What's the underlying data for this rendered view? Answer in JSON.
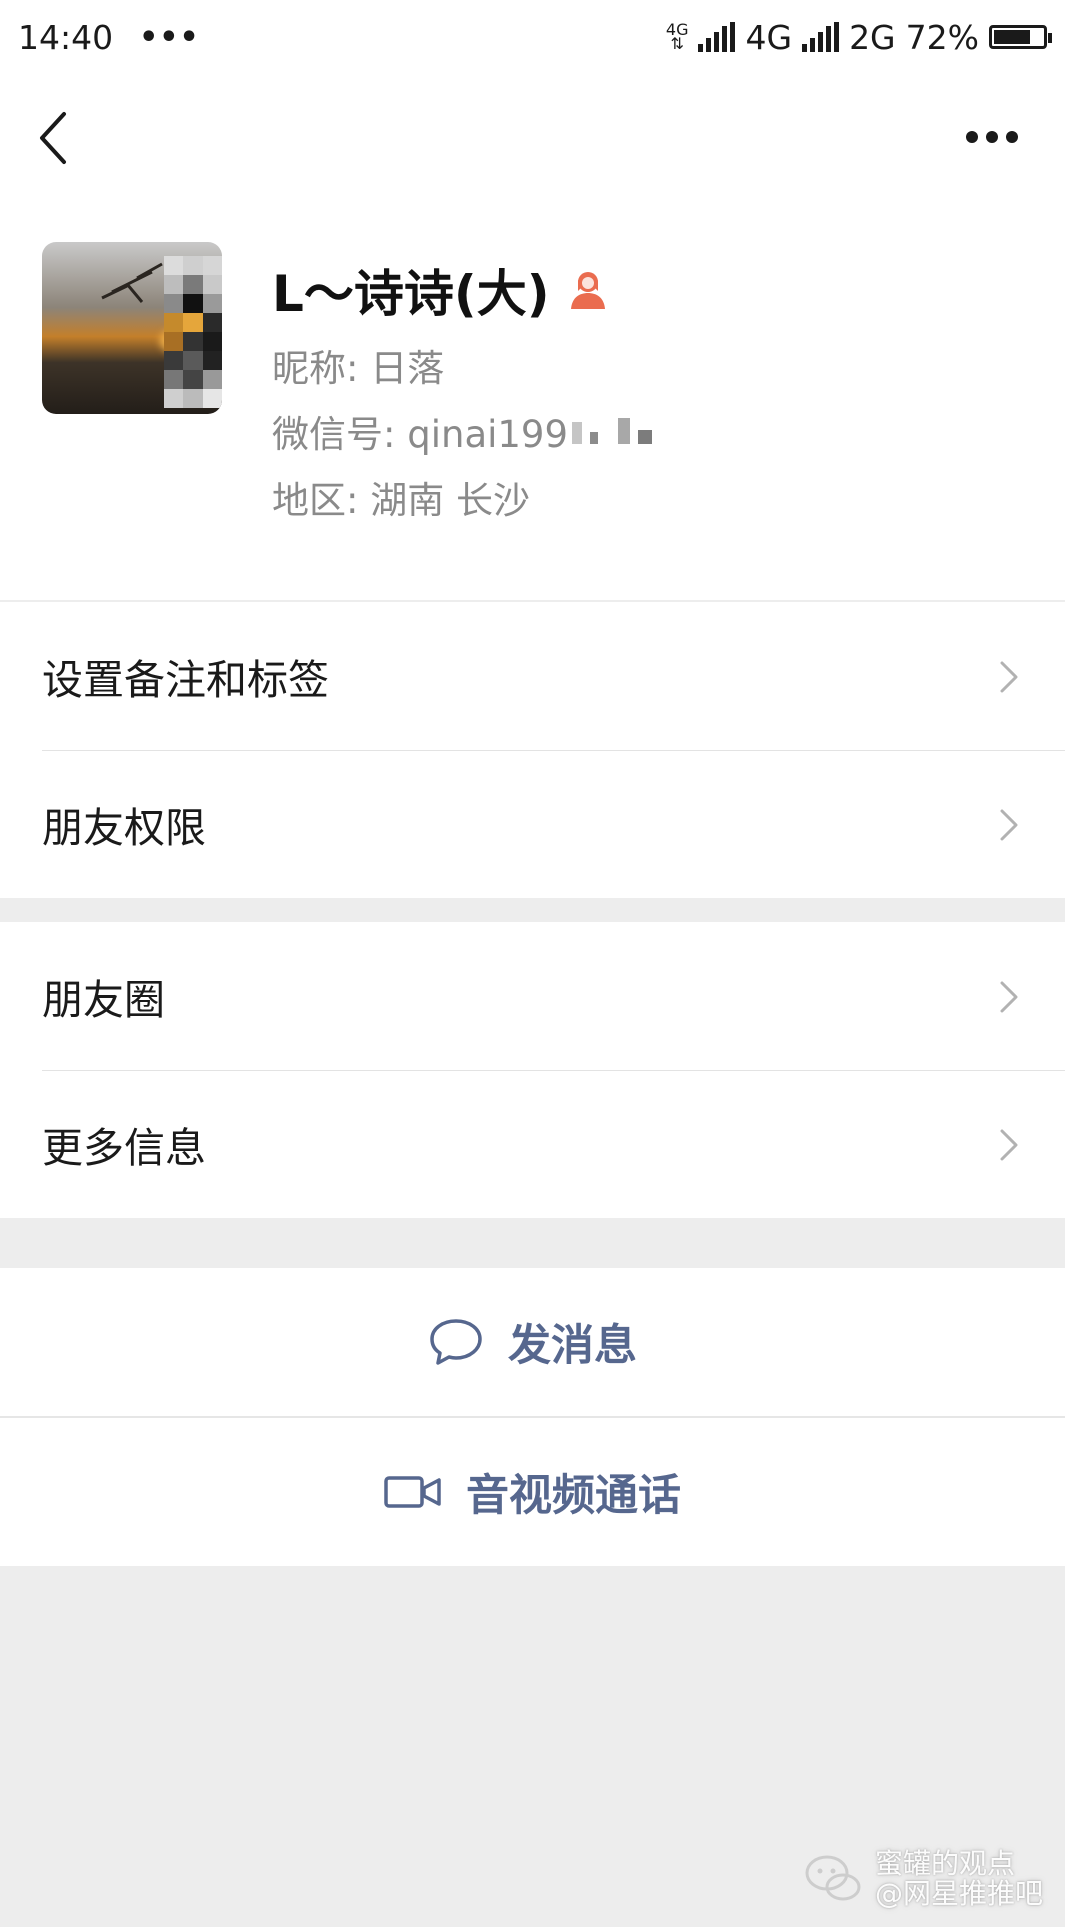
{
  "status_bar": {
    "time": "14:40",
    "overflow_dots": "•••",
    "network_badge": "4G",
    "sim1_network": "4G",
    "sim2_network": "2G",
    "battery_percent": "72%",
    "battery_level": 0.72
  },
  "profile": {
    "name": "L～诗诗(大)",
    "gender": "female",
    "gender_icon_color": "#ea6c4f",
    "nickname": "昵称: 日落",
    "wechat_id": "微信号: qinai199",
    "region": "地区: 湖南  长沙"
  },
  "menu_group_1": [
    {
      "label": "设置备注和标签"
    },
    {
      "label": "朋友权限"
    }
  ],
  "menu_group_2": [
    {
      "label": "朋友圈"
    },
    {
      "label": "更多信息"
    }
  ],
  "actions": {
    "send_message": "发消息",
    "av_call": "音视频通话",
    "accent_color": "#56678e"
  },
  "watermark": {
    "line1": "蜜罐的观点",
    "line2": "@网星推推吧"
  }
}
